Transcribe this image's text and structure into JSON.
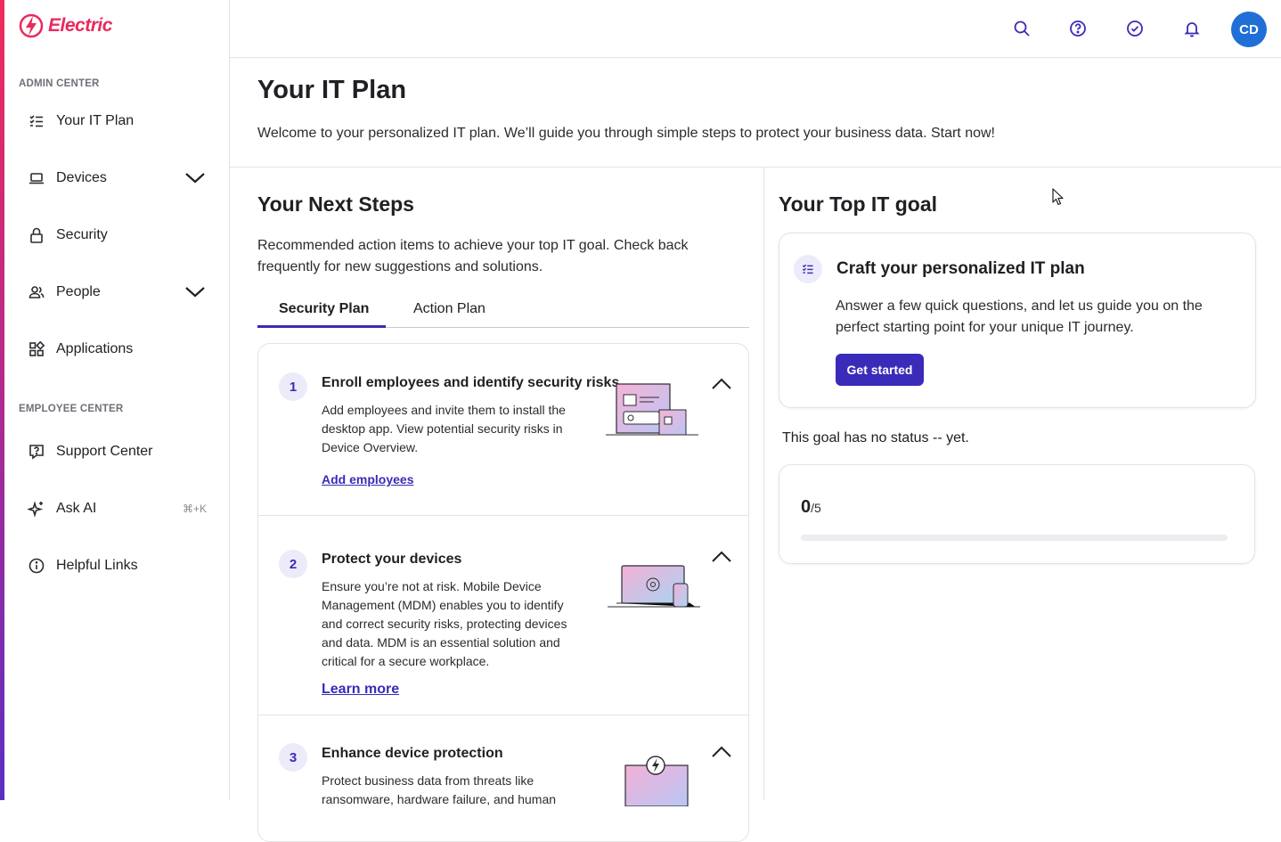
{
  "app": {
    "brand": "Electric"
  },
  "sidebar": {
    "admin_label": "ADMIN CENTER",
    "employee_label": "EMPLOYEE CENTER",
    "items": [
      {
        "label": "Your IT Plan",
        "icon": "list-check-icon"
      },
      {
        "label": "Devices",
        "icon": "laptop-icon"
      },
      {
        "label": "Security",
        "icon": "lock-icon"
      },
      {
        "label": "People",
        "icon": "people-icon"
      },
      {
        "label": "Applications",
        "icon": "apps-grid-icon"
      },
      {
        "label": "Support Center",
        "icon": "help-chat-icon"
      },
      {
        "label": "Ask AI",
        "icon": "sparkle-icon",
        "shortcut": "⌘+K"
      },
      {
        "label": "Helpful Links",
        "icon": "info-icon"
      }
    ]
  },
  "topbar": {
    "avatar_initials": "CD"
  },
  "page": {
    "title": "Your IT Plan",
    "subtitle": "Welcome to your personalized IT plan. We’ll guide you through simple steps to protect your business data. Start now!"
  },
  "next_steps": {
    "title": "Your Next Steps",
    "description": "Recommended action items to achieve your top IT goal. Check back frequently for new suggestions and solutions.",
    "tabs": [
      "Security Plan",
      "Action Plan"
    ],
    "active_tab": "Security Plan",
    "steps": [
      {
        "number": "1",
        "title": "Enroll employees and identify security risks",
        "body": "Add employees and invite them to install the desktop app. View potential security risks in Device Overview.",
        "link": "Add employees"
      },
      {
        "number": "2",
        "title": "Protect your devices",
        "body": "Ensure you’re not at risk. Mobile Device Management (MDM) enables you to identify and correct security risks, protecting devices and data. MDM is an essential solution and critical for a secure workplace.",
        "link": "Learn more"
      },
      {
        "number": "3",
        "title": "Enhance device protection",
        "body": "Protect business data from threats like ransomware, hardware failure, and human"
      }
    ]
  },
  "goal": {
    "title": "Your Top IT goal",
    "card_title": "Craft your personalized IT plan",
    "card_desc": "Answer a few quick questions, and let us guide you on the perfect starting point for your unique IT journey.",
    "button": "Get started",
    "status": "This goal has no status -- yet.",
    "progress_done": "0",
    "progress_total": "/5",
    "progress_fraction": 0
  },
  "colors": {
    "brand": "#ea2a5c",
    "primary": "#3a2bb8",
    "avatar": "#1f6fd6"
  }
}
